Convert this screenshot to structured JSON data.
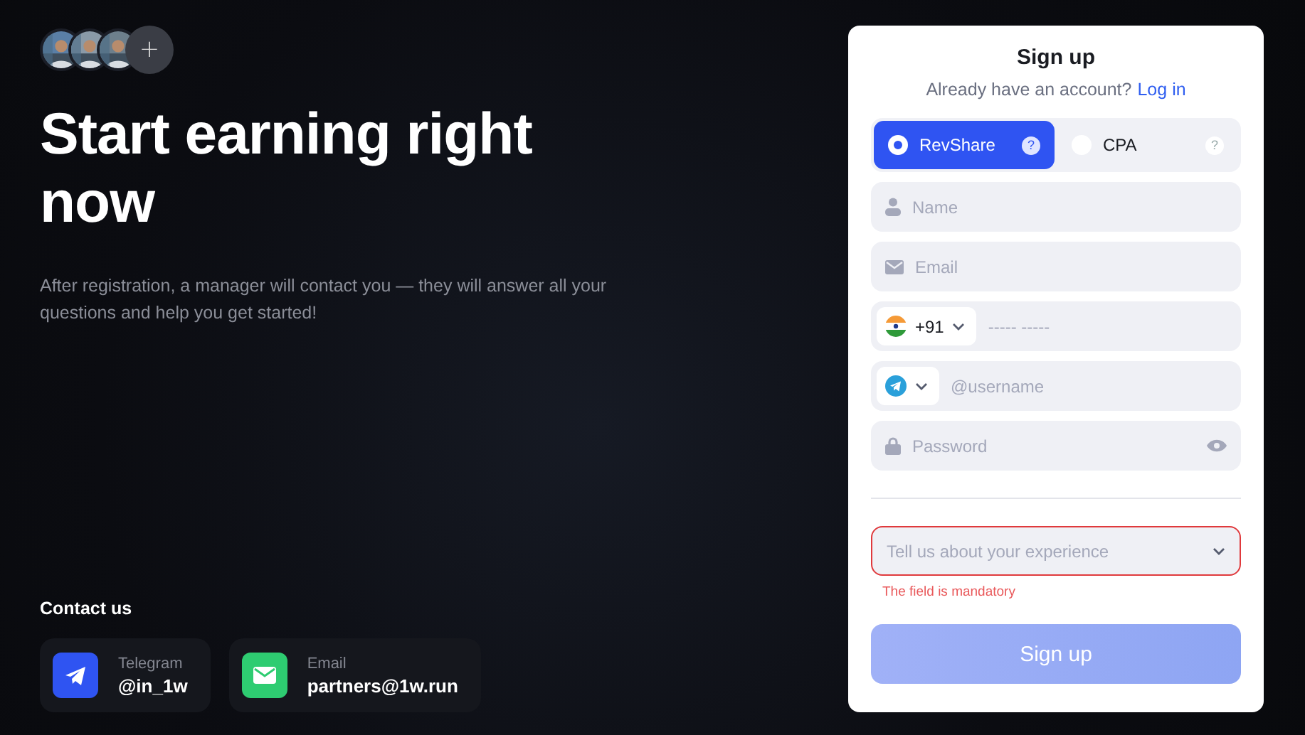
{
  "avatars_more": "+",
  "headline": "Start earning right now",
  "description": "After registration, a manager will contact you — they will answer all your questions and help you get started!",
  "contact": {
    "title": "Contact us",
    "cards": [
      {
        "kind": "telegram",
        "label": "Telegram",
        "value": "@in_1w"
      },
      {
        "kind": "email",
        "label": "Email",
        "value": "partners@1w.run"
      }
    ]
  },
  "form": {
    "title": "Sign up",
    "login_prompt": "Already have an account?",
    "login_link": "Log in",
    "tabs": [
      {
        "label": "RevShare",
        "help": "?",
        "selected": true
      },
      {
        "label": "CPA",
        "help": "?",
        "selected": false
      }
    ],
    "fields": [
      {
        "kind": "name",
        "placeholder": "Name"
      },
      {
        "kind": "email",
        "placeholder": "Email"
      },
      {
        "kind": "phone",
        "code": "+91",
        "placeholder": "----- -----"
      },
      {
        "kind": "messenger",
        "placeholder": "@username"
      },
      {
        "kind": "password",
        "placeholder": "Password"
      }
    ],
    "experience": {
      "placeholder": "Tell us about your experience",
      "invalid": true,
      "error": "The field is mandatory"
    },
    "submit": "Sign up"
  }
}
